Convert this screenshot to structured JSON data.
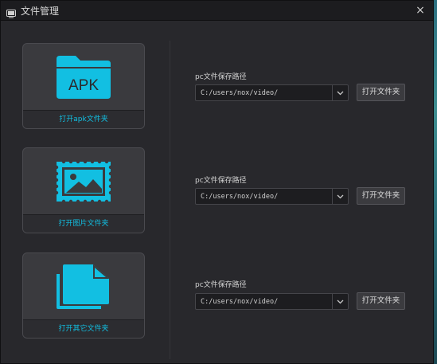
{
  "window": {
    "title": "文件管理",
    "close_glyph": "×"
  },
  "colors": {
    "accent": "#12bfe2",
    "background": "#28282c",
    "titlebar": "#1c1c1f"
  },
  "sections": [
    {
      "icon": "apk-folder-icon",
      "icon_text": "APK",
      "card_label": "打开apk文件夹",
      "path_label": "pc文件保存路径",
      "path_value": "C:/users/nox/video/",
      "open_button": "打开文件夹"
    },
    {
      "icon": "image-icon",
      "card_label": "打开图片文件夹",
      "path_label": "pc文件保存路径",
      "path_value": "C:/users/nox/video/",
      "open_button": "打开文件夹"
    },
    {
      "icon": "documents-icon",
      "card_label": "打开其它文件夹",
      "path_label": "pc文件保存路径",
      "path_value": "C:/users/nox/video/",
      "open_button": "打开文件夹"
    }
  ]
}
